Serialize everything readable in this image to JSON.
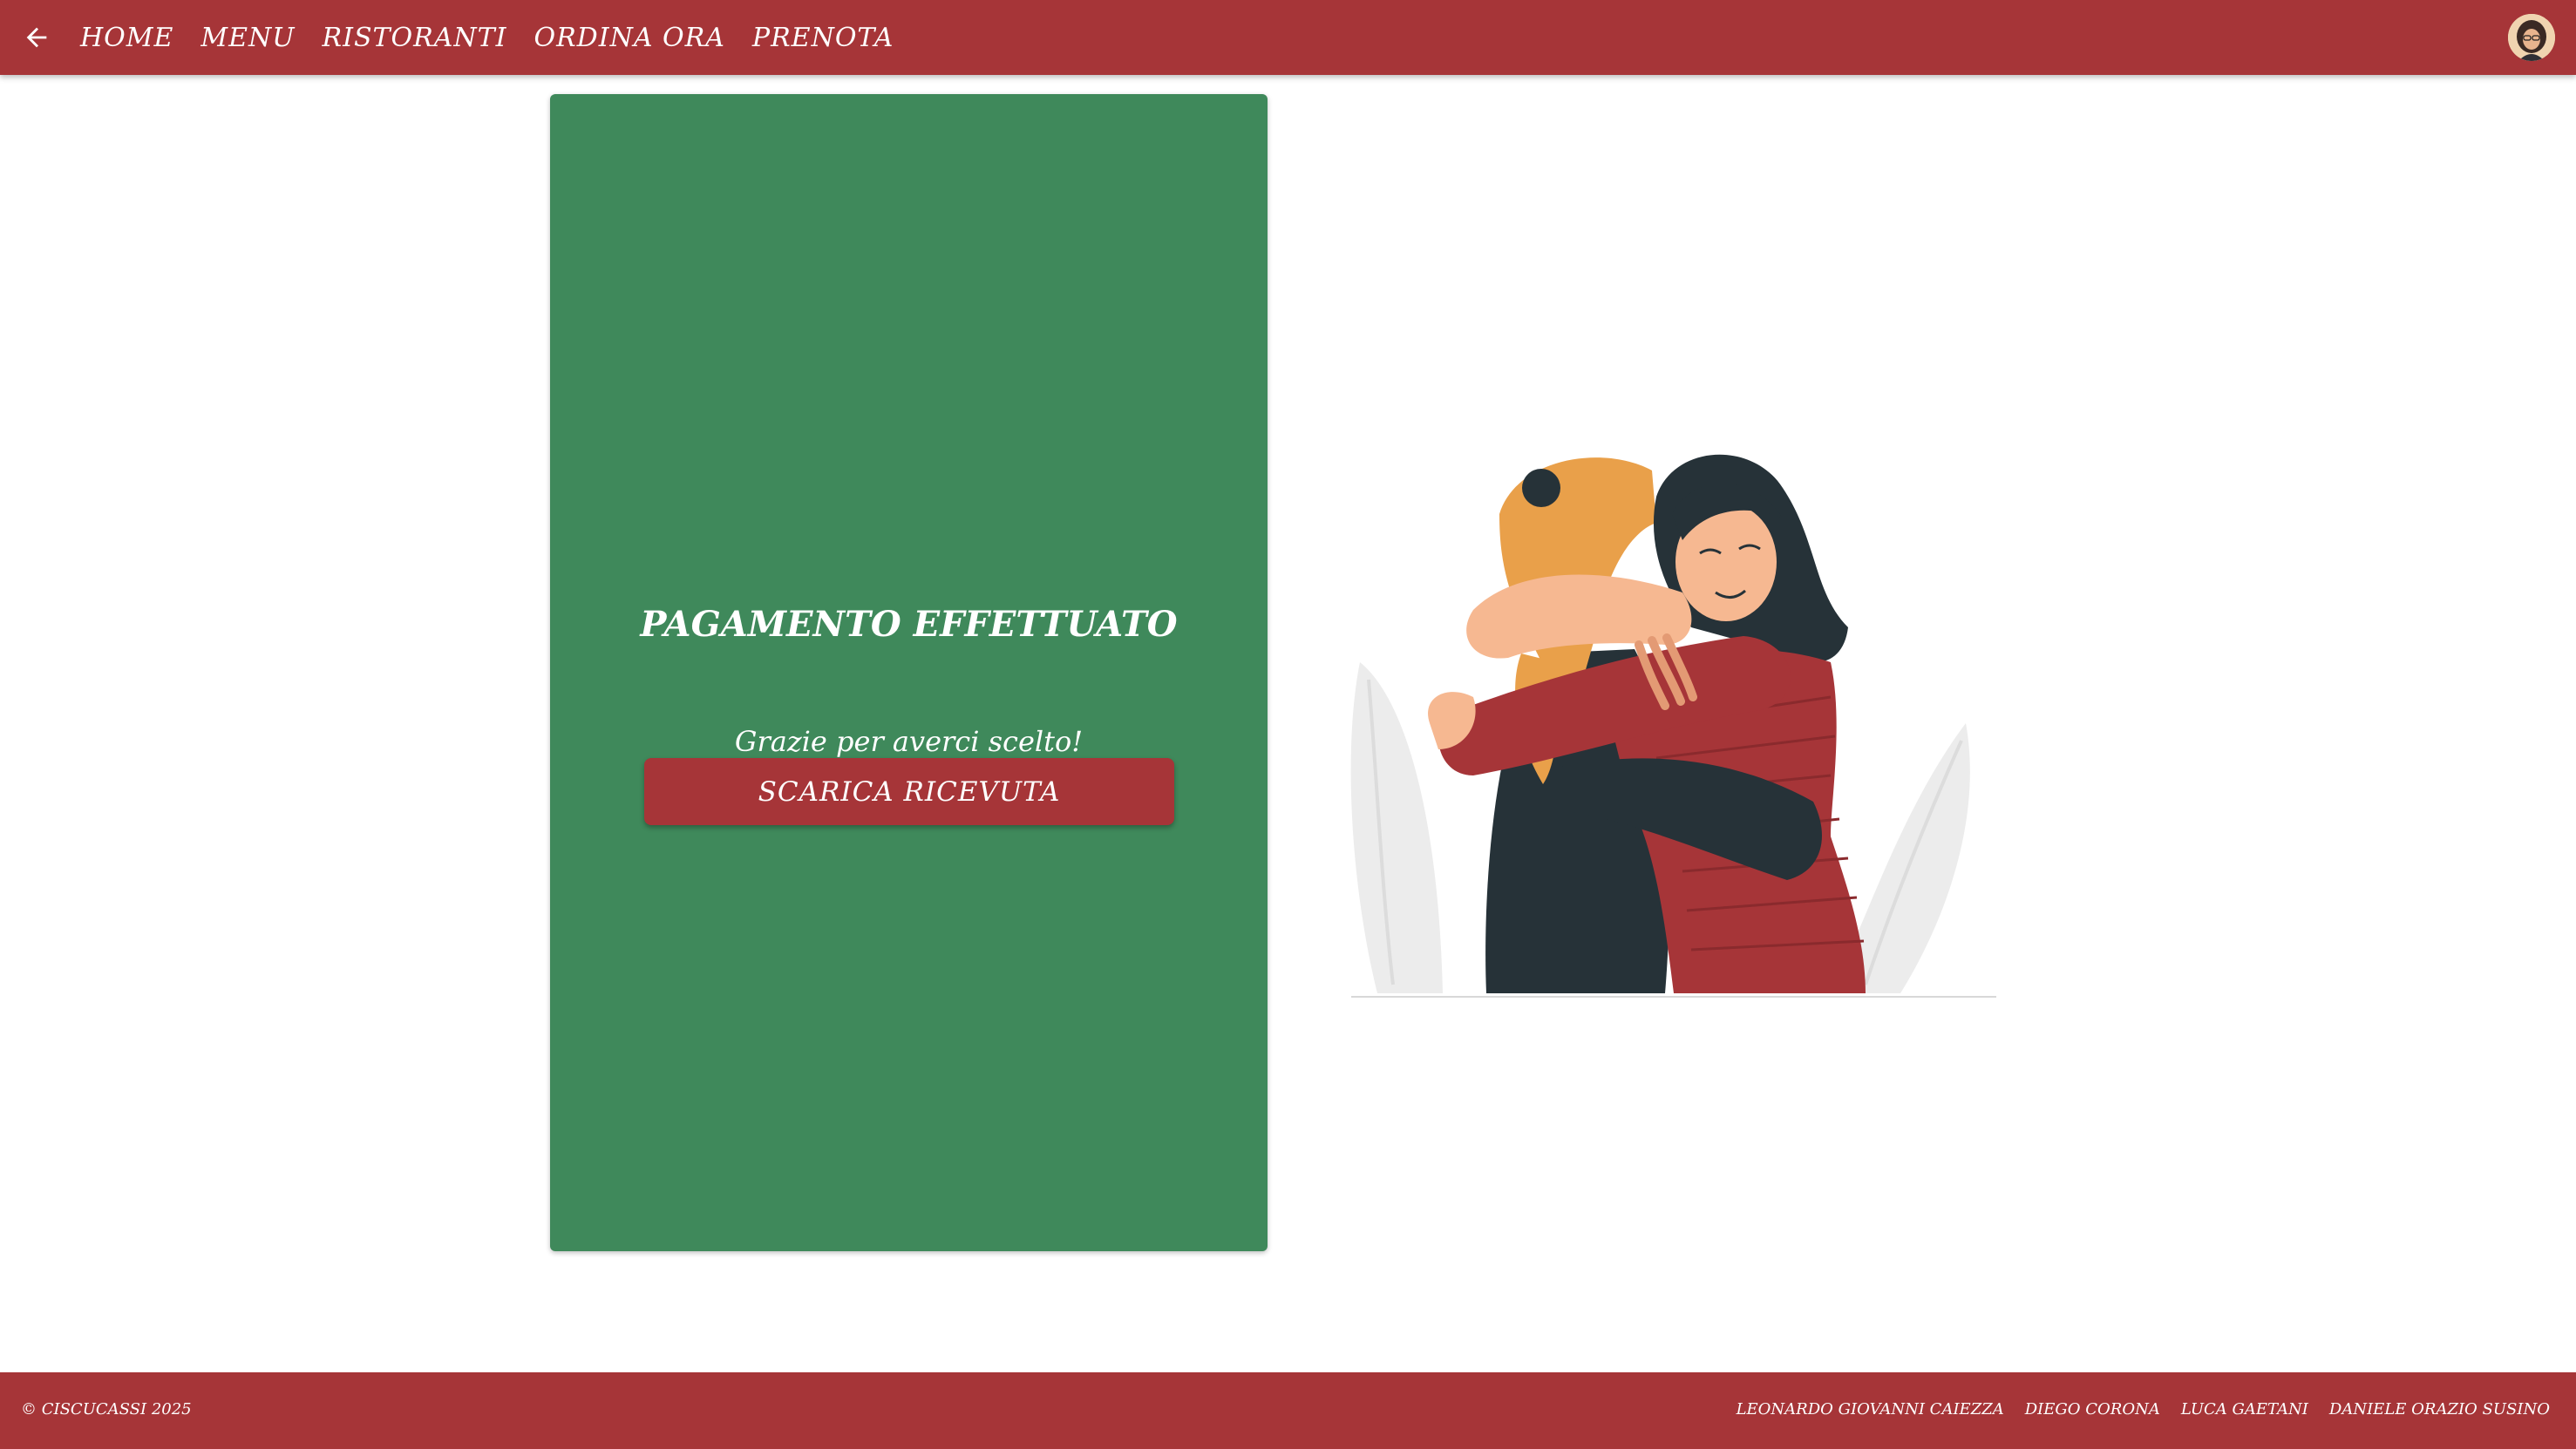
{
  "header": {
    "back_icon": "arrow-left-icon",
    "nav": [
      {
        "label": "HOME"
      },
      {
        "label": "MENU"
      },
      {
        "label": "RISTORANTI"
      },
      {
        "label": "ORDINA ORA"
      },
      {
        "label": "PRENOTA"
      }
    ],
    "avatar_icon": "user-avatar"
  },
  "main": {
    "title": "PAGAMENTO EFFETTUATO",
    "subtitle": "Grazie per averci scelto!",
    "button_label": "SCARICA RICEVUTA",
    "illustration": "two-people-hugging-illustration"
  },
  "footer": {
    "copyright": "© CISCUCASSI 2025",
    "authors": [
      "LEONARDO GIOVANNI CAIEZZA",
      "DIEGO CORONA",
      "LUCA GAETANI",
      "DANIELE ORAZIO SUSINO"
    ]
  },
  "colors": {
    "brand_red": "#a63538",
    "card_green": "#3f895b",
    "text_white": "#ffffff"
  }
}
